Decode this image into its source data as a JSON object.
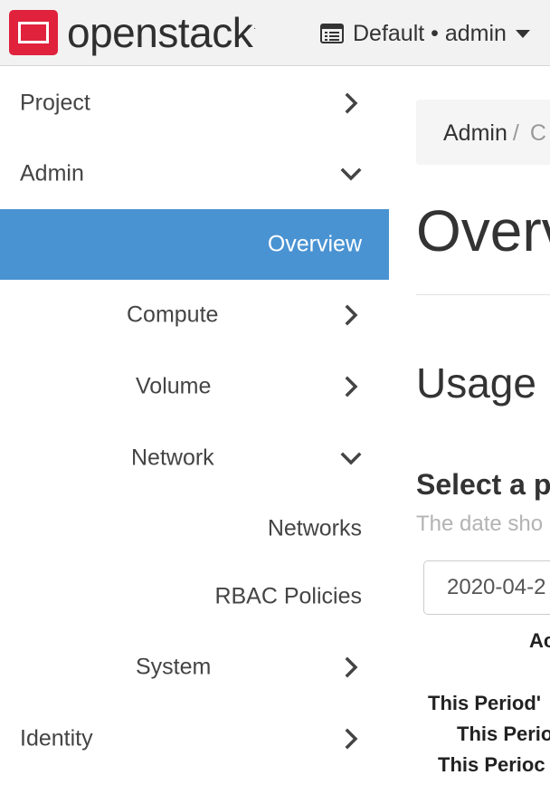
{
  "header": {
    "logo_text": "openstack",
    "logo_registered": ".",
    "project_picker_label": "Default • admin",
    "colors": {
      "logo_red": "#e0223d",
      "bar_bg": "#f2f2f2"
    }
  },
  "sidebar": {
    "items": [
      {
        "label": "Project",
        "chevron": "right"
      },
      {
        "label": "Admin",
        "chevron": "down"
      },
      {
        "label": "Overview",
        "active": true
      },
      {
        "label": "Compute",
        "chevron": "right"
      },
      {
        "label": "Volume",
        "chevron": "right"
      },
      {
        "label": "Network",
        "chevron": "down"
      },
      {
        "label": "Networks"
      },
      {
        "label": "RBAC Policies"
      },
      {
        "label": "System",
        "chevron": "right"
      },
      {
        "label": "Identity",
        "chevron": "right"
      }
    ],
    "colors": {
      "active_bg": "#4a93d2"
    }
  },
  "main": {
    "breadcrumb": {
      "first": "Admin",
      "separator": "/",
      "next": "C"
    },
    "page_title": "Overv",
    "section_title": "Usage",
    "period_title": "Select a p",
    "help_text": "The date sho",
    "date_value": "2020-04-2",
    "truncated_lines": [
      "Ac",
      "This Period'",
      "This Perio",
      "This Perioc"
    ]
  }
}
